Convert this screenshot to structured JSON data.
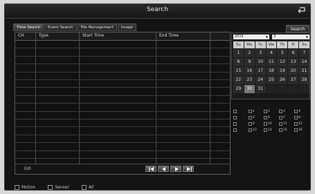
{
  "window": {
    "title": "Search"
  },
  "tabs": [
    {
      "label": "Time Search"
    },
    {
      "label": "Event Search"
    },
    {
      "label": "File Management"
    },
    {
      "label": "Image"
    }
  ],
  "search_button": "Search",
  "table": {
    "columns": [
      "CH",
      "Type",
      "Start Time",
      "End Time"
    ],
    "rows": [],
    "page_count": "0/0"
  },
  "calendar": {
    "year": "2015",
    "month": "3",
    "weekdays": [
      "Su",
      "Mo",
      "Tu",
      "We",
      "Th",
      "Fr",
      "Sa"
    ],
    "days": [
      "1",
      "2",
      "3",
      "4",
      "5",
      "6",
      "7",
      "8",
      "9",
      "10",
      "11",
      "12",
      "13",
      "14",
      "15",
      "16",
      "17",
      "18",
      "19",
      "20",
      "21",
      "22",
      "23",
      "24",
      "25",
      "26",
      "27",
      "28",
      "29",
      "30",
      "31"
    ],
    "selected_day": "30"
  },
  "channels": [
    "1",
    "2",
    "3",
    "4",
    "5",
    "6",
    "7",
    "8",
    "9",
    "10",
    "11",
    "12",
    "13",
    "14",
    "15",
    "16"
  ],
  "filters": [
    {
      "label": "Motion"
    },
    {
      "label": "Sensor"
    },
    {
      "label": "All"
    }
  ]
}
